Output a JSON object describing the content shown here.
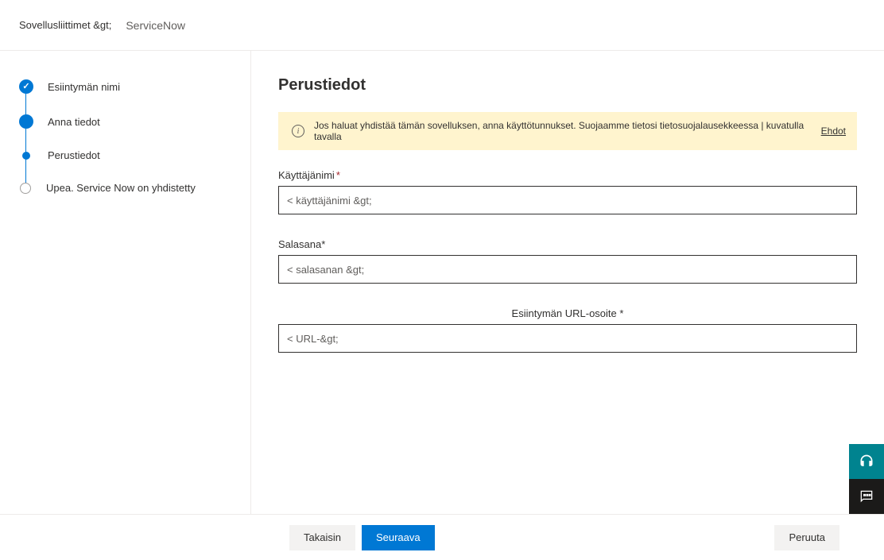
{
  "header": {
    "breadcrumb": "Sovellusliittimet &gt;",
    "app_name": "ServiceNow"
  },
  "sidebar": {
    "steps": [
      {
        "label": "Esiintymän nimi"
      },
      {
        "label": "Anna tiedot"
      },
      {
        "label": "Perustiedot"
      },
      {
        "label": "Upea. Service Now on yhdistetty"
      }
    ]
  },
  "main": {
    "title": "Perustiedot",
    "banner": {
      "text": "Jos haluat yhdistää tämän sovelluksen, anna käyttötunnukset. Suojaamme tietosi tietosuojalausekkeessa | kuvatulla tavalla",
      "link_label": "Ehdot"
    },
    "fields": {
      "username": {
        "label": "Käyttäjänimi",
        "value": "< käyttäjänimi &gt;"
      },
      "password": {
        "label": "Salasana*",
        "value": "< salasanan &gt;"
      },
      "url": {
        "label": "Esiintymän URL-osoite *",
        "value": "< URL-&gt;"
      }
    }
  },
  "footer": {
    "back": "Takaisin",
    "next": "Seuraava",
    "cancel": "Peruuta"
  }
}
